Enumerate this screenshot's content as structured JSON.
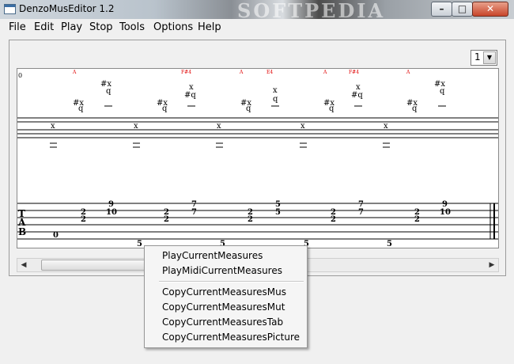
{
  "window": {
    "title": "DenzoMusEditor 1.2",
    "watermark": "SOFTPEDIA",
    "buttons": {
      "minimize": "–",
      "maximize": "□",
      "close": "✕"
    }
  },
  "menu": {
    "items": [
      "File",
      "Edit",
      "Play",
      "Stop",
      "Tools",
      "Options",
      "Help"
    ]
  },
  "toolbar": {
    "measure_select": {
      "value": "1"
    }
  },
  "score": {
    "start_label": "0",
    "chord_names": [
      "A",
      "F#4",
      "A",
      "E4",
      "A",
      "F#4",
      "A"
    ],
    "tab_clef": [
      "T",
      "A",
      "B"
    ],
    "notation": {
      "sharp_x": "#x",
      "q": "q",
      "x": "x",
      "sharp_q": "#q"
    },
    "tab_numbers": {
      "open_b": "0",
      "two": "2",
      "five": "5",
      "seven": "7",
      "nine": "9",
      "ten": "10"
    }
  },
  "context_menu": {
    "items": [
      "PlayCurrentMeasures",
      "PlayMidiCurrentMeasures",
      "CopyCurrentMeasuresMus",
      "CopyCurrentMeasuresMut",
      "CopyCurrentMeasuresTab",
      "CopyCurrentMeasuresPicture"
    ]
  },
  "colors": {
    "chord_name": "#e00000",
    "staff_lines": "#000000"
  }
}
